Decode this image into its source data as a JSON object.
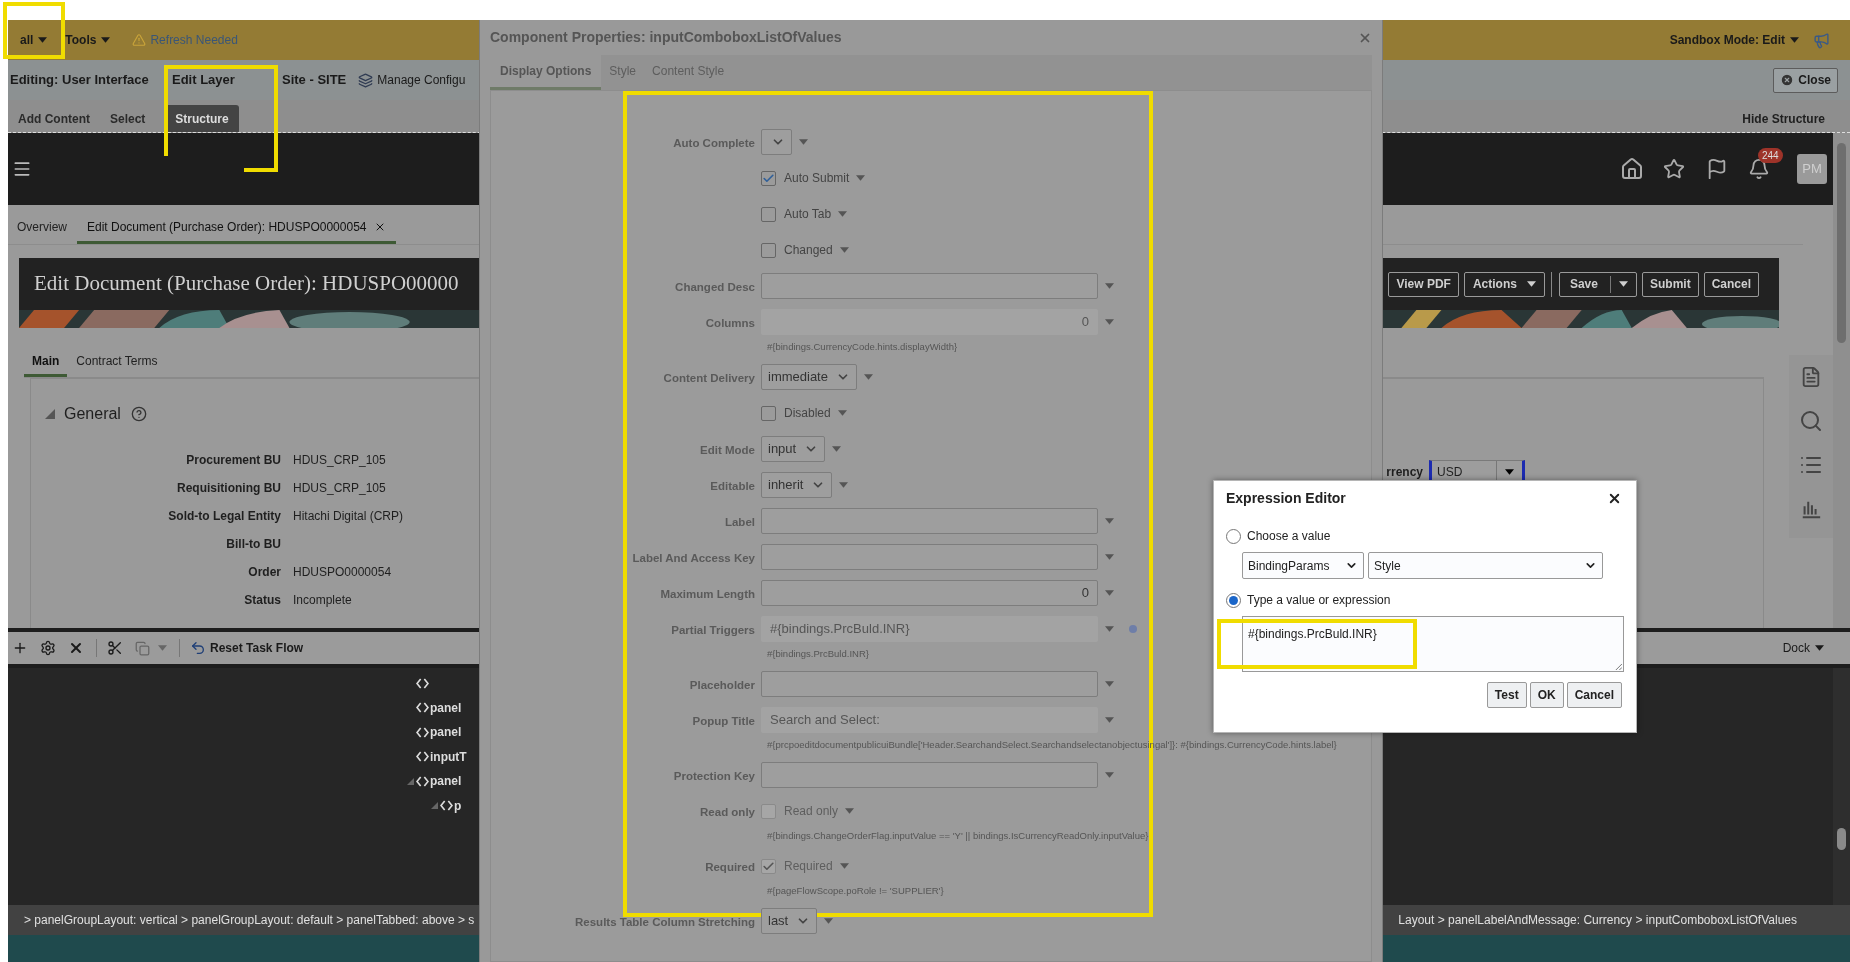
{
  "top_bar": {
    "menus": [
      {
        "label": "all"
      },
      {
        "label": "Tools"
      }
    ],
    "refresh_notice": "Refresh Needed",
    "sandbox_mode": "Sandbox Mode: Edit"
  },
  "edit_bar": {
    "editing": "Editing: User Interface",
    "edit_layer": "Edit Layer",
    "site": "Site - SITE",
    "manage": "Manage Configu",
    "close": "Close"
  },
  "composer_tabs": [
    {
      "label": "Add Content",
      "selected": false
    },
    {
      "label": "Select",
      "selected": false
    },
    {
      "label": "Structure",
      "selected": true
    }
  ],
  "hide_structure": "Hide Structure",
  "header": {
    "notification_count": "244",
    "avatar": "PM"
  },
  "page_tabs": [
    {
      "label": "Overview",
      "selected": false
    },
    {
      "label": "Edit Document (Purchase Order): HDUSPO0000054",
      "selected": true
    }
  ],
  "banner": {
    "title": "Edit Document (Purchase Order): HDUSPO00000",
    "buttons": [
      {
        "label": "View PDF",
        "kind": "plain"
      },
      {
        "label": "Actions",
        "kind": "menu"
      },
      {
        "label": "Save",
        "kind": "split"
      },
      {
        "label": "Submit",
        "kind": "plain"
      },
      {
        "label": "Cancel",
        "kind": "plain"
      }
    ]
  },
  "doc_tabs": [
    {
      "label": "Main",
      "selected": true
    },
    {
      "label": "Contract Terms",
      "selected": false
    }
  ],
  "section": {
    "title": "General",
    "fields": [
      {
        "label": "Procurement BU",
        "value": "HDUS_CRP_105"
      },
      {
        "label": "Requisitioning BU",
        "value": "HDUS_CRP_105"
      },
      {
        "label": "Sold-to Legal Entity",
        "value": "Hitachi Digital (CRP)"
      },
      {
        "label": "Bill-to BU"
      },
      {
        "label": "Order",
        "value": "HDUSPO0000054"
      },
      {
        "label": "Status",
        "value": "Incomplete"
      }
    ]
  },
  "currency": {
    "label": "rrency",
    "value": "USD"
  },
  "structure_toolbar": {
    "reset": "Reset Task Flow",
    "dock": "Dock"
  },
  "tree": [
    {
      "expanded": false
    },
    {
      "label": "panel",
      "expanded": false
    },
    {
      "label": "panel",
      "expanded": false
    },
    {
      "label": "inputT",
      "expanded": false
    },
    {
      "label": "panel",
      "expanded": true,
      "children": [
        {
          "label": "p",
          "expanded": true
        }
      ]
    }
  ],
  "breadcrumb": {
    "left": "> panelGroupLayout: vertical > panelGroupLayout: default > panelTabbed: above > s",
    "right": "Layout > panelLabelAndMessage: Currency > inputComboboxListOfValues"
  },
  "properties_dialog": {
    "title": "Component Properties: inputComboboxListOfValues",
    "tabs": [
      {
        "label": "Display Options",
        "selected": true
      },
      {
        "label": "Style",
        "selected": false
      },
      {
        "label": "Content Style",
        "selected": false
      }
    ],
    "rows": [
      {
        "kind": "select",
        "label": "Auto Complete"
      },
      {
        "kind": "check",
        "text": "Auto Submit",
        "checked": true,
        "disabled": false
      },
      {
        "kind": "check",
        "text": "Auto Tab",
        "checked": false,
        "disabled": false
      },
      {
        "kind": "check",
        "text": "Changed",
        "checked": false,
        "disabled": false
      },
      {
        "kind": "text",
        "label": "Changed Desc",
        "disabled": false
      },
      {
        "kind": "number",
        "label": "Columns",
        "value": "0",
        "disabled": true,
        "hint": "#{bindings.CurrencyCode.hints.displayWidth}"
      },
      {
        "kind": "select",
        "label": "Content Delivery",
        "value": "immediate"
      },
      {
        "kind": "check",
        "text": "Disabled",
        "checked": false,
        "disabled": false
      },
      {
        "kind": "select",
        "label": "Edit Mode",
        "value": "input"
      },
      {
        "kind": "select",
        "label": "Editable",
        "value": "inherit"
      },
      {
        "kind": "text",
        "label": "Label",
        "disabled": false
      },
      {
        "kind": "text",
        "label": "Label And Access Key",
        "disabled": false
      },
      {
        "kind": "number",
        "label": "Maximum Length",
        "value": "0",
        "disabled": false
      },
      {
        "kind": "text",
        "label": "Partial Triggers",
        "value": "#{bindings.PrcBuld.INR}",
        "disabled": true,
        "marked": true,
        "hint": "#{bindings.PrcBuld.INR}"
      },
      {
        "kind": "text",
        "label": "Placeholder",
        "disabled": false
      },
      {
        "kind": "text",
        "label": "Popup Title",
        "value": "Search and Select:",
        "disabled": true,
        "hint": "#{prcpoeditdocumentpublicuiBundle['Header.SearchandSelect.Searchandselectanobjectusingal']}: #{bindings.CurrencyCode.hints.label}"
      },
      {
        "kind": "text",
        "label": "Protection Key",
        "disabled": false
      },
      {
        "kind": "check",
        "label": "Read only",
        "text": "Read only",
        "checked": false,
        "disabled": true,
        "hint": "#{bindings.ChangeOrderFlag.inputValue == 'Y' || bindings.IsCurrencyReadOnly.inputValue}"
      },
      {
        "kind": "check",
        "label": "Required",
        "text": "Required",
        "checked": true,
        "disabled": true,
        "hint": "#{pageFlowScope.poRole != 'SUPPLIER'}"
      },
      {
        "kind": "select",
        "label": "Results Table Column Stretching",
        "value": "last"
      }
    ]
  },
  "expression_editor": {
    "title": "Expression Editor",
    "options": [
      {
        "label": "Choose a value",
        "selected": false
      },
      {
        "label": "Type a value or expression",
        "selected": true
      }
    ],
    "selects": [
      {
        "value": "BindingParams"
      },
      {
        "value": "Style"
      }
    ],
    "expression": "#{bindings.PrcBuld.INR}",
    "buttons": [
      "Test",
      "OK",
      "Cancel"
    ]
  }
}
